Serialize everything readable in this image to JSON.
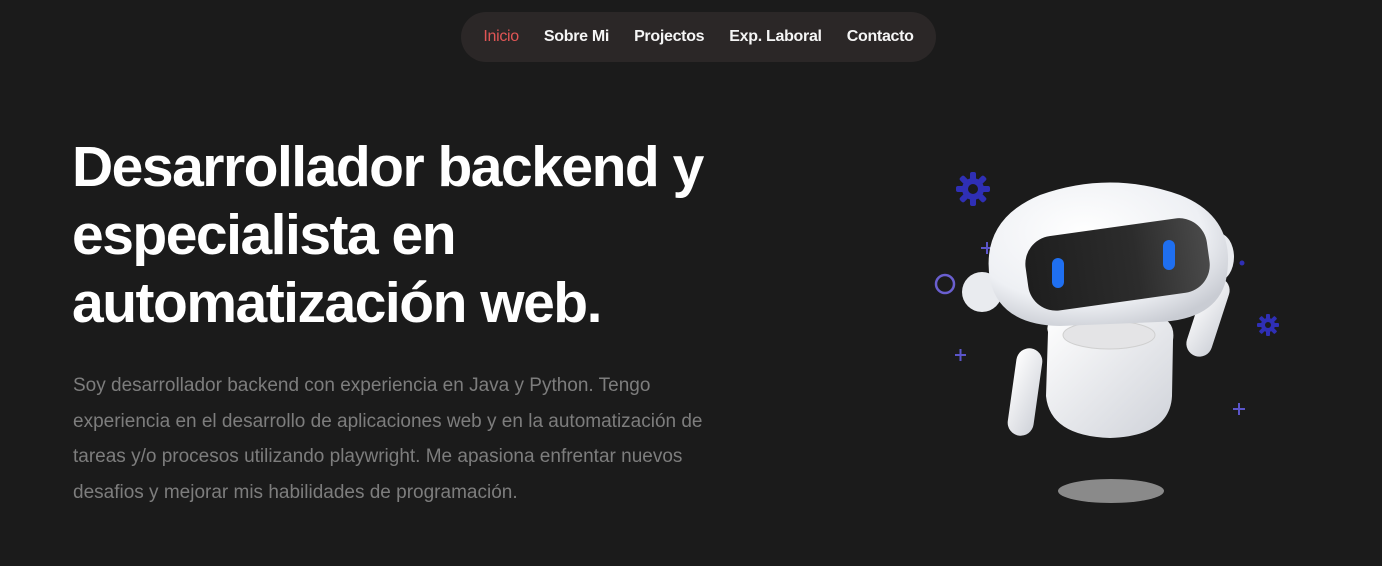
{
  "nav": {
    "items": [
      {
        "label": "Inicio",
        "active": true
      },
      {
        "label": "Sobre Mi",
        "active": false
      },
      {
        "label": "Projectos",
        "active": false
      },
      {
        "label": "Exp. Laboral",
        "active": false
      },
      {
        "label": "Contacto",
        "active": false
      }
    ]
  },
  "hero": {
    "title": "Desarrollador backend y especialista en automatización web.",
    "description": "Soy desarrollador backend con experiencia en Java y Python. Tengo experiencia en el desarrollo de aplicaciones web y en la automatización de tareas y/o procesos utilizando playwright. Me apasiona enfrentar nuevos desafios y mejorar mis habilidades de programación."
  },
  "illustration": {
    "name": "robot-illustration",
    "accent_color": "#1f6ff0",
    "decoration_color": "#2f2fb5"
  },
  "colors": {
    "background": "#1b1b1b",
    "nav_background": "#2b2727",
    "active_link": "#e05555",
    "text_primary": "#ffffff",
    "text_muted": "#7d7d7d"
  }
}
